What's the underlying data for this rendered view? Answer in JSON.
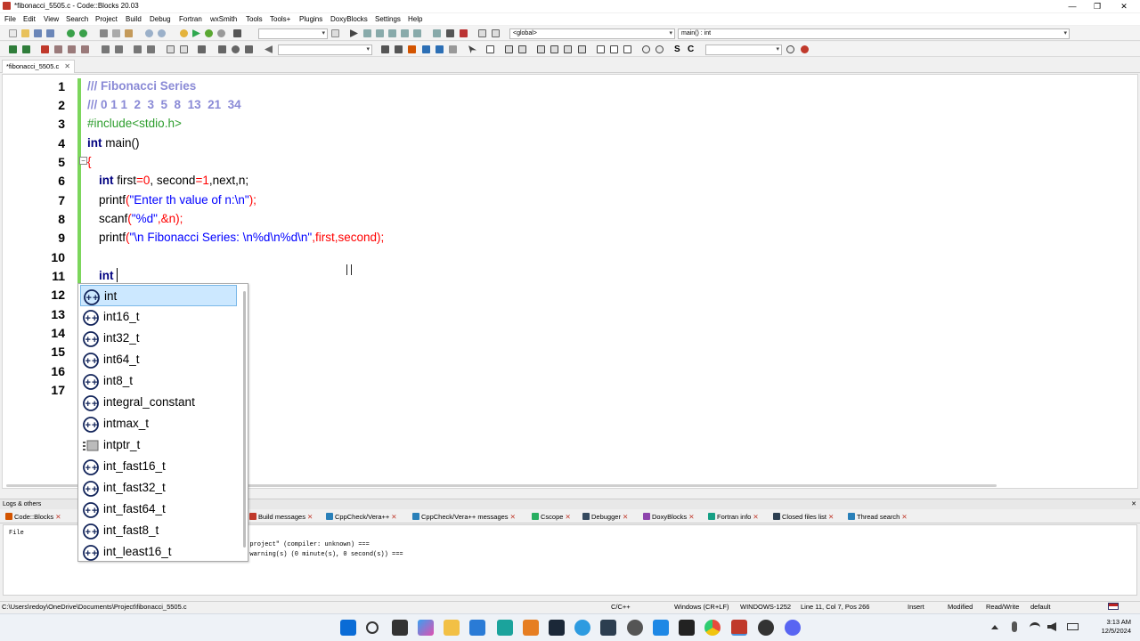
{
  "window": {
    "title": "*fibonacci_5505.c - Code::Blocks 20.03",
    "minimize": "—",
    "maximize": "❐",
    "close": "✕"
  },
  "menu": [
    "File",
    "Edit",
    "View",
    "Search",
    "Project",
    "Build",
    "Debug",
    "Fortran",
    "wxSmith",
    "Tools",
    "Tools+",
    "Plugins",
    "DoxyBlocks",
    "Settings",
    "Help"
  ],
  "toolbar": {
    "scope_combo": "<global>",
    "function_combo": "main() : int",
    "target_combo": "",
    "search_combo": ""
  },
  "editor": {
    "file_tab": "*fibonacci_5505.c",
    "tab_close": "✕",
    "line_numbers": [
      "1",
      "2",
      "3",
      "4",
      "5",
      "6",
      "7",
      "8",
      "9",
      "10",
      "11",
      "12",
      "13",
      "14",
      "15",
      "16",
      "17"
    ],
    "fold_marker": "−",
    "lines": {
      "l1": "/// Fibonacci Series",
      "l2": "/// 0 1 1  2  3  5  8  13  21  34",
      "l3": "#include<stdio.h>",
      "l4_kw": "int",
      "l4_rest": " main()",
      "l5": "{",
      "l6_kw": "int",
      "l6_a": " first",
      "l6_b": "=",
      "l6_c": "0",
      "l6_d": ", second",
      "l6_e": "=",
      "l6_f": "1",
      "l6_g": ",next,n;",
      "l7_a": "printf",
      "l7_b": "(",
      "l7_c": "\"Enter th value of n:\\n\"",
      "l7_d": ");",
      "l8_a": "scanf",
      "l8_b": "(",
      "l8_c": "\"%d\"",
      "l8_d": ",&n);",
      "l9_a": "printf",
      "l9_b": "(",
      "l9_c": "\"\\n Fibonacci Series: \\n%d\\n%d\\n\"",
      "l9_d": ",first,second);",
      "l11": "int"
    }
  },
  "autocomplete": {
    "items": [
      {
        "label": "int",
        "icon": "class-icon",
        "selected": true
      },
      {
        "label": "int16_t",
        "icon": "class-icon"
      },
      {
        "label": "int32_t",
        "icon": "class-icon"
      },
      {
        "label": "int64_t",
        "icon": "class-icon"
      },
      {
        "label": "int8_t",
        "icon": "class-icon"
      },
      {
        "label": "integral_constant",
        "icon": "class-icon"
      },
      {
        "label": "intmax_t",
        "icon": "class-icon"
      },
      {
        "label": "intptr_t",
        "icon": "typedef-icon"
      },
      {
        "label": "int_fast16_t",
        "icon": "class-icon"
      },
      {
        "label": "int_fast32_t",
        "icon": "class-icon"
      },
      {
        "label": "int_fast64_t",
        "icon": "class-icon"
      },
      {
        "label": "int_fast8_t",
        "icon": "class-icon"
      },
      {
        "label": "int_least16_t",
        "icon": "class-icon"
      }
    ]
  },
  "logs": {
    "header": "Logs & others",
    "close": "✕",
    "tabs": [
      {
        "label": "Code::Blocks",
        "color": "#d35400"
      },
      {
        "label": "Build messages",
        "color": "#c0392b"
      },
      {
        "label": "CppCheck/Vera++",
        "color": "#2980b9"
      },
      {
        "label": "CppCheck/Vera++ messages",
        "color": "#2980b9"
      },
      {
        "label": "Cscope",
        "color": "#27ae60"
      },
      {
        "label": "Debugger",
        "color": "#34495e"
      },
      {
        "label": "DoxyBlocks",
        "color": "#8e44ad"
      },
      {
        "label": "Fortran info",
        "color": "#16a085"
      },
      {
        "label": "Closed files list",
        "color": "#2c3e50"
      },
      {
        "label": "Thread search",
        "color": "#2980b9"
      }
    ],
    "tab_close": "✕",
    "column_file": "File",
    "line1": "o project\" (compiler: unknown) ===",
    "line2": ") warning(s) (0 minute(s), 0 second(s)) ==="
  },
  "status": {
    "path": "C:\\Users\\redoy\\OneDrive\\Documents\\Project\\fibonacci_5505.c",
    "lang": "C/C++",
    "eol": "Windows (CR+LF)",
    "encoding": "WINDOWS-1252",
    "position": "Line 11, Col 7, Pos 266",
    "mode": "Insert",
    "modified": "Modified",
    "access": "Read/Write",
    "profile": "default"
  },
  "taskbar": {
    "time": "3:13 AM",
    "date": "12/5/2024",
    "apps": [
      "windows-start-icon",
      "search-icon",
      "task-view-icon",
      "copilot-icon",
      "file-explorer-icon",
      "store-icon",
      "snipping-tool-icon",
      "matlab-icon",
      "steam-icon",
      "edge-icon",
      "vpn-icon",
      "chatgpt-icon",
      "vscode-icon",
      "epic-games-icon",
      "chrome-icon",
      "codeblocks-icon",
      "obs-icon",
      "discord-icon"
    ]
  },
  "colors": {
    "comment": "#8a8ad6",
    "keyword": "#000080",
    "preprocessor": "#2e9e2e",
    "string": "#0000ff",
    "number": "#ff0000",
    "selection": "#cce8ff",
    "change_bar": "#7cd65c"
  }
}
